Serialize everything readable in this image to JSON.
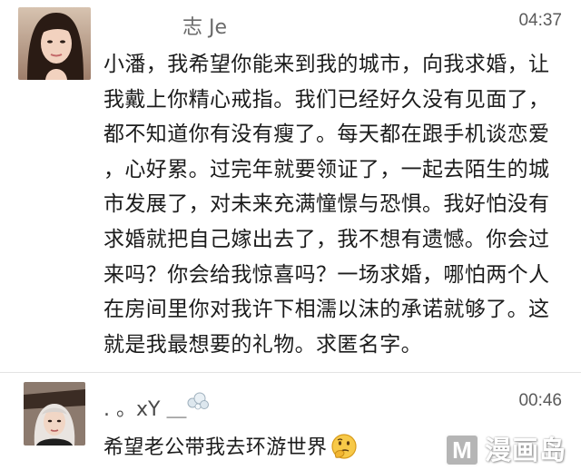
{
  "messages": [
    {
      "username": "志 Je",
      "time": "04:37",
      "lines": [
        "小潘，我希望你能来到我的城市，向我求婚，让",
        "我戴上你精心戒指。我们已经好久没有见面了，",
        "都不知道你有没有瘦了。每天都在跟手机谈恋爱",
        "，心好累。过完年就要领证了，一起去陌生的城",
        "市发展了，对未来充满憧憬与恐惧。我好怕没有",
        "求婚就把自己嫁出去了，我不想有遗憾。你会过",
        "来吗？你会给我惊喜吗？一场求婚，哪怕两个人",
        "在房间里你对我许下相濡以沫的承诺就够了。这",
        "就是我最想要的礼物。求匿名字。"
      ]
    },
    {
      "username": ". 。xY ＿",
      "time": "00:46",
      "text": "希望老公带我去环游世界"
    }
  ],
  "icons": {
    "sticker": "bubble-sticker-icon",
    "emoji": "thinking-face-emoji"
  },
  "watermark": {
    "badge": "M",
    "text": "漫画岛"
  },
  "colors": {
    "background": "#ffffff",
    "text": "#1c1c1c",
    "time": "#5a5a5a",
    "divider": "#e3e3e3"
  }
}
